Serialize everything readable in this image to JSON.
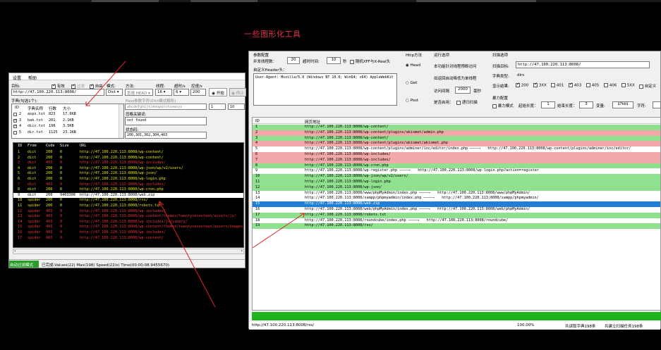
{
  "page": {
    "heading": "一些图形化工具"
  },
  "left": {
    "menu": [
      "设置",
      "帮助"
    ],
    "target_label": "目标:",
    "target_value": "http://47.100.220.113:8008/",
    "cb_valid": "有效",
    "cb_filter": "过滤",
    "cb_mode_on": "自由",
    "mode_label": "模式:",
    "mode_value": "Dict",
    "method_label": "方法:",
    "method_value": "盲速 HEAD",
    "threads_label": "线程:",
    "threads_value": "16",
    "timeout_label": "超时/s",
    "timeout_value": "6",
    "rate_label": "控速/s",
    "rate_value": "200",
    "start_label": "开始",
    "stop_label": "停止",
    "dict_label": "字典(勾选1个):",
    "dict_headers": [
      "ID",
      "字典名称",
      "行数",
      "大小"
    ],
    "dicts": [
      {
        "id": "2",
        "name": "aspx.txt",
        "lines": "823",
        "size": "17.6KB",
        "on": false
      },
      {
        "id": "3",
        "name": "bak.txt",
        "lines": "201",
        "size": "2.1KB",
        "on": true
      },
      {
        "id": "4",
        "name": "dicc.txt",
        "lines": "198",
        "size": "3.5KB",
        "on": true
      },
      {
        "id": "5",
        "name": "dir.txt",
        "lines": "1125",
        "size": "23.1KB",
        "on": false
      }
    ],
    "pass_hint": "Pass参数字符(Dict模式解析)",
    "pass_value": "abcdefghijklmnopqrstuvwxyz",
    "num1": "1",
    "num2": "10",
    "ignore_label": "忽略关键词:",
    "ignore_value": "not found",
    "code_label": "状态码:",
    "code_value": "200,301,302,304,403",
    "res_headers": [
      "ID",
      "From",
      "Code",
      "Size",
      "URL"
    ],
    "results": [
      {
        "id": "1",
        "from": "dict",
        "code": "200",
        "size": "0",
        "url": "http://47.100.220.113:8008/wp-content/",
        "c": "#e8e800"
      },
      {
        "id": "2",
        "from": "dict",
        "code": "200",
        "size": "0",
        "url": "http://47.100.220.113:8008/wp-content/",
        "c": "#e8e800"
      },
      {
        "id": "3",
        "from": "dict",
        "code": "403",
        "size": "0",
        "url": "http://47.100.220.113:8008/wp-includes/",
        "c": "#e8323a"
      },
      {
        "id": "4",
        "from": "dict",
        "code": "200",
        "size": "0",
        "url": "http://47.100.220.113:8008/wp-json/wp/v2/users/",
        "c": "#e8e800"
      },
      {
        "id": "5",
        "from": "dict",
        "code": "200",
        "size": "0",
        "url": "http://47.100.220.113:8008/wp-json/",
        "c": "#e8e800"
      },
      {
        "id": "6",
        "from": "dict",
        "code": "200",
        "size": "0",
        "url": "http://47.100.220.113:8008/wp-login.php",
        "c": "#e8e800"
      },
      {
        "id": "7",
        "from": "dict",
        "code": "403",
        "size": "0",
        "url": "http://47.100.220.113:8008/wp-includes/",
        "c": "#e8323a"
      },
      {
        "id": "8",
        "from": "dict",
        "code": "200",
        "size": "0",
        "url": "http://47.100.220.113:8008/wp-cron.php",
        "c": "#e8e800"
      },
      {
        "id": "9",
        "from": "dict",
        "code": "200",
        "size": "9403308",
        "url": "http://47.100.220.113:8008/web.zip",
        "c": "#ffffff",
        "sel": true
      },
      {
        "id": "10",
        "from": "spider",
        "code": "200",
        "size": "0",
        "url": "http://47.100.220.113:8008/rss/",
        "c": "#e8e800"
      },
      {
        "id": "11",
        "from": "spider",
        "code": "200",
        "size": "0",
        "url": "http://47.100.220.113:8008/robots.txt",
        "c": "#e8e800"
      },
      {
        "id": "12",
        "from": "spider",
        "code": "403",
        "size": "0",
        "url": "http://47.100.220.113:8008/wp-includes/",
        "c": "#e8323a"
      },
      {
        "id": "13",
        "from": "spider",
        "code": "403",
        "size": "0",
        "url": "http://47.100.220.113:8008/wp-content/themes/twentyseventeen/assets/js/",
        "c": "#e8323a"
      },
      {
        "id": "14",
        "from": "spider",
        "code": "403",
        "size": "0",
        "url": "http://47.100.220.113:8008/wp-includes/js/jquery/",
        "c": "#e8323a"
      },
      {
        "id": "15",
        "from": "spider",
        "code": "403",
        "size": "0",
        "url": "http://47.100.220.113:8008/wp-content/themes/twentyseventeen/assets/images/",
        "c": "#e8323a"
      },
      {
        "id": "16",
        "from": "spider",
        "code": "403",
        "size": "0",
        "url": "http://47.100.220.113:8008/wp-includes/",
        "c": "#e8323a"
      },
      {
        "id": "17",
        "from": "spider",
        "code": "403",
        "size": "0",
        "url": "http://47.100.220.113:8008/wp-content/",
        "c": "#e8323a"
      }
    ],
    "status_mode": "自动过滤模式",
    "status_text": "已完成:Values(22) Max(198) Speed(22/s) Time(00:00:08.9455670)"
  },
  "right": {
    "param_title": "参数配置",
    "concurrency_label": "并发线程数：",
    "concurrency_value": "20",
    "timeout_label": "超时时间:",
    "timeout_value": "10",
    "sec": "秒",
    "random_xff": "随机XFF与X-Real头",
    "custom_header_label": "自定义Header头：",
    "header_value": "User-Agent: Mozilla/5.0 (Windows NT 10.0; Win64; x64) AppleWebKit",
    "http_method_title": "Http方法",
    "m_head": "Head",
    "m_get": "Get",
    "m_post": "Post",
    "run_opts_title": "运行选项",
    "opt1": "本功能针对线程预断访问",
    "opt2": "如返回自动降低为单线程",
    "interval_label": "访问间隔",
    "interval_value": "2000",
    "ms": "毫秒",
    "recursive_label": "是否启用：",
    "recursive_check": "递归扫描",
    "scan_title": "扫描选项",
    "scan_target_label": "扫描目标:",
    "scan_target_value": "http://47.100.220.113:8008/",
    "dict_type_label": "字典类型:",
    "dict_type_value": "dirs",
    "show_result_label": "显示结果:",
    "codes": [
      {
        "c": "200",
        "on": true
      },
      {
        "c": "3XX",
        "on": true
      },
      {
        "c": "401",
        "on": false
      },
      {
        "c": "403",
        "on": true
      },
      {
        "c": "405",
        "on": false
      },
      {
        "c": "406",
        "on": false
      },
      {
        "c": "5XX",
        "on": false
      },
      {
        "c": "自定义",
        "on": false
      }
    ],
    "brute_title": "暴力配置",
    "brute_mode": "暴力模式",
    "start_len_label": "起始长度：",
    "start_len": "1",
    "end_len_label": "结束长度：",
    "end_len": "3",
    "var_label": "变量:",
    "var_value": "$7kb$",
    "charset_label": "字符:",
    "grid_headers": [
      "ID",
      "网页地址"
    ],
    "rows": [
      {
        "id": "1",
        "url": "http://47.100.220.113:8008/wp-content/",
        "t": "g"
      },
      {
        "id": "2",
        "url": "http://47.100.220.113:8008/wp-content/plugins/akismet/admin.php",
        "t": "r"
      },
      {
        "id": "3",
        "url": "http://47.100.220.113:8008/wp-content/",
        "t": "g"
      },
      {
        "id": "4",
        "url": "http://47.100.220.113:8008/wp-content/plugins/akismet/akismet.php",
        "t": "r"
      },
      {
        "id": "5",
        "url": "http://47.100.220.113:8008/wp-content/plugins/adminer/inc/editor/index.php",
        "t": "w",
        "redir": "http://47.100.220.113:8008/wp-content/plugins/adminer/inc/editor/"
      },
      {
        "id": "6",
        "url": "http://47.100.220.113:8008/wp-includes/",
        "t": "r"
      },
      {
        "id": "7",
        "url": "http://47.100.220.113:8008/wp-includes/",
        "t": "r"
      },
      {
        "id": "8",
        "url": "http://47.100.220.113:8008/wp-cron.php",
        "t": "g"
      },
      {
        "id": "9",
        "url": "http://47.100.220.113:8008/wp-register.php",
        "t": "w",
        "redir": "http://47.100.220.113:8008/wp-login.php?action=register"
      },
      {
        "id": "10",
        "url": "http://47.100.220.113:8008/wp-json/wp/v2/users/",
        "t": "g"
      },
      {
        "id": "11",
        "url": "http://47.100.220.113:8008/wp-login.php",
        "t": "g"
      },
      {
        "id": "12",
        "url": "http://47.100.220.113:8008/wp-json/",
        "t": "g"
      },
      {
        "id": "13",
        "url": "http://47.100.220.113:8008/www/phpMyAdmin/index.php",
        "t": "w",
        "redir": "http://47.100.220.113:8008/www/phpMyAdmin/"
      },
      {
        "id": "14",
        "url": "http://47.100.220.113:8008/xampp/phpmyadmin/index.php",
        "t": "w",
        "redir": "http://47.100.220.113:8008/xampp/phpmyadmin/"
      },
      {
        "id": "15",
        "url": "http://47.100.220.113:8008/web.zip",
        "t": "s"
      },
      {
        "id": "16",
        "url": "http://47.100.220.113:8008/web/phpMyAdmin/index.php",
        "t": "w",
        "redir": "http://47.100.220.113:8008/web/phpMyAdmin/"
      },
      {
        "id": "17",
        "url": "http://47.100.220.113:8008/robots.txt",
        "t": "g"
      },
      {
        "id": "18",
        "url": "http://47.100.220.113:8008/roundcube/index.php",
        "t": "w",
        "redir": "http://47.100.220.113:8008/roundcube/"
      },
      {
        "id": "19",
        "url": "http://47.100.220.113:8008/rss/",
        "t": "g"
      }
    ],
    "status_url": "http://47.100.220.113:8008/rss/",
    "status_pct": "100.00%",
    "status_total": "共读取字典198条",
    "status_tasks": "共建立扫描任务198条"
  }
}
